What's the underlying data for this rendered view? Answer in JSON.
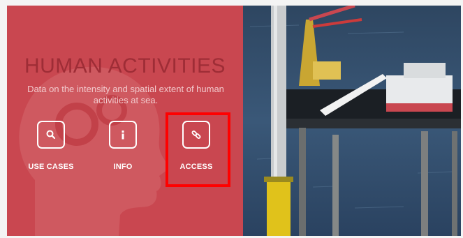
{
  "panel": {
    "title": "HUMAN ACTIVITIES",
    "subtitle": "Data on the intensity and spatial extent of human activities at sea.",
    "bg_color": "#c94750"
  },
  "actions": [
    {
      "label": "USE CASES",
      "icon": "search-icon"
    },
    {
      "label": "INFO",
      "icon": "info-icon"
    },
    {
      "label": "ACCESS",
      "icon": "link-icon",
      "highlighted": true
    }
  ],
  "highlight_color": "#ff0000",
  "photo": {
    "subject": "offshore wind turbine installation platform at sea"
  }
}
